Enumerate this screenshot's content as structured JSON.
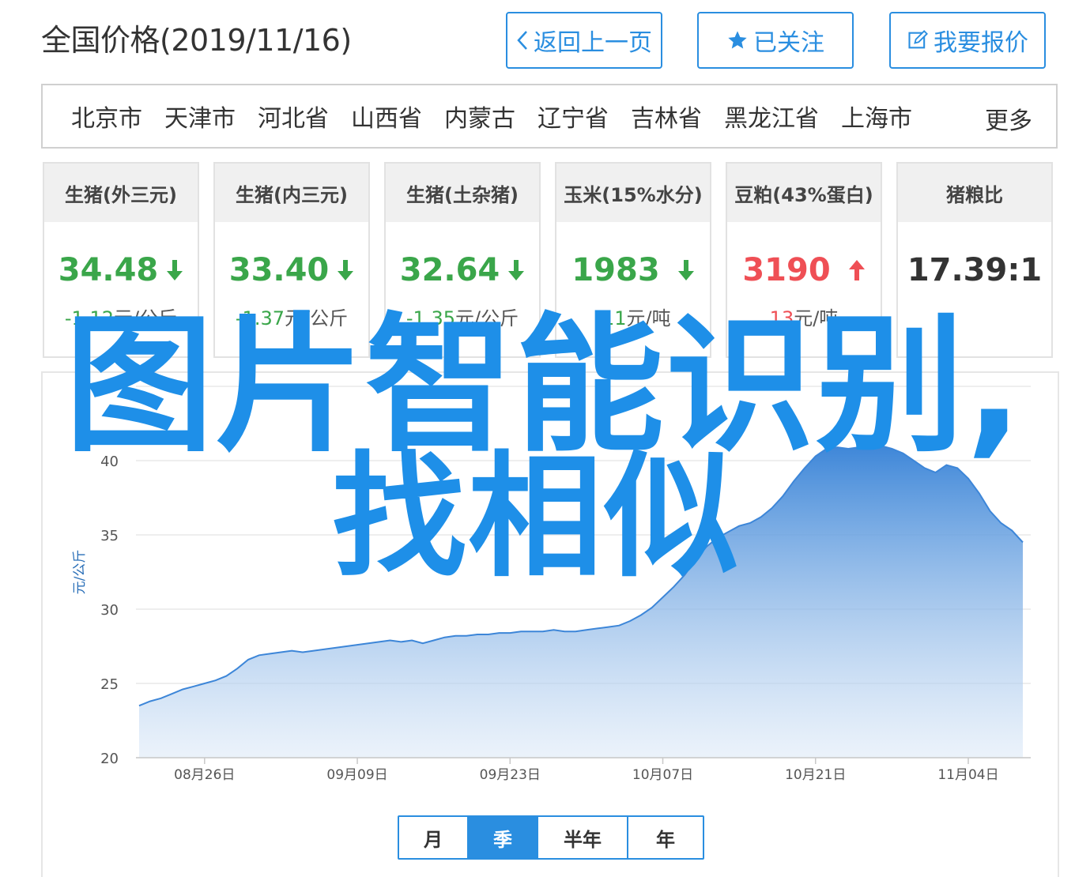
{
  "page_title": "全国价格(2019/11/16)",
  "buttons": {
    "back": "返回上一页",
    "followed": "已关注",
    "report": "我要报价"
  },
  "regions": [
    "北京市",
    "天津市",
    "河北省",
    "山西省",
    "内蒙古",
    "辽宁省",
    "吉林省",
    "黑龙江省",
    "上海市"
  ],
  "regions_more": "更多",
  "cards": [
    {
      "title": "生猪(外三元)",
      "value": "34.48",
      "trend": "down",
      "change_num": "-1.12",
      "change_unit": "元/公斤"
    },
    {
      "title": "生猪(内三元)",
      "value": "33.40",
      "trend": "down",
      "change_num": "-1.37",
      "change_unit": "元/公斤"
    },
    {
      "title": "生猪(土杂猪)",
      "value": "32.64",
      "trend": "down",
      "change_num": "-1.35",
      "change_unit": "元/公斤"
    },
    {
      "title": "玉米(15%水分)",
      "value": "1983",
      "trend": "down",
      "change_num": "-11",
      "change_unit": "元/吨"
    },
    {
      "title": "豆粕(43%蛋白)",
      "value": "3190",
      "trend": "up",
      "change_num": "13",
      "change_unit": "元/吨"
    },
    {
      "title": "猪粮比",
      "value": "17.39:1",
      "trend": "none",
      "change_num": "",
      "change_unit": ""
    }
  ],
  "colors": {
    "accent": "#2a8ee0",
    "down": "#3aa64a",
    "up": "#ef4f55",
    "area_top": "#3d86d8",
    "area_bottom": "#dbe8f7"
  },
  "watermark": {
    "line1": "图片智能识别,",
    "line2": "找相似"
  },
  "period_tabs": [
    "月",
    "季",
    "半年",
    "年"
  ],
  "period_active": "季",
  "chart_data": {
    "type": "area",
    "ylabel": "元/公斤",
    "ylim": [
      20,
      45
    ],
    "y_ticks": [
      20,
      25,
      30,
      35,
      40
    ],
    "x_tick_labels": [
      "08月26日",
      "09月09日",
      "09月23日",
      "10月07日",
      "10月21日",
      "11月04日"
    ],
    "x_tick_index": [
      6,
      20,
      34,
      48,
      62,
      76
    ],
    "values": [
      23.5,
      23.8,
      24.0,
      24.3,
      24.6,
      24.8,
      25.0,
      25.2,
      25.5,
      26.0,
      26.6,
      26.9,
      27.0,
      27.1,
      27.2,
      27.1,
      27.2,
      27.3,
      27.4,
      27.5,
      27.6,
      27.7,
      27.8,
      27.9,
      27.8,
      27.9,
      27.7,
      27.9,
      28.1,
      28.2,
      28.2,
      28.3,
      28.3,
      28.4,
      28.4,
      28.5,
      28.5,
      28.5,
      28.6,
      28.5,
      28.5,
      28.6,
      28.7,
      28.8,
      28.9,
      29.2,
      29.6,
      30.1,
      30.8,
      31.5,
      32.3,
      33.3,
      34.2,
      34.8,
      35.2,
      35.6,
      35.8,
      36.2,
      36.8,
      37.6,
      38.6,
      39.5,
      40.3,
      40.8,
      40.9,
      40.8,
      40.9,
      41.1,
      41.0,
      40.8,
      40.5,
      40.0,
      39.5,
      39.2,
      39.7,
      39.5,
      38.8,
      37.8,
      36.6,
      35.8,
      35.3,
      34.5
    ]
  }
}
